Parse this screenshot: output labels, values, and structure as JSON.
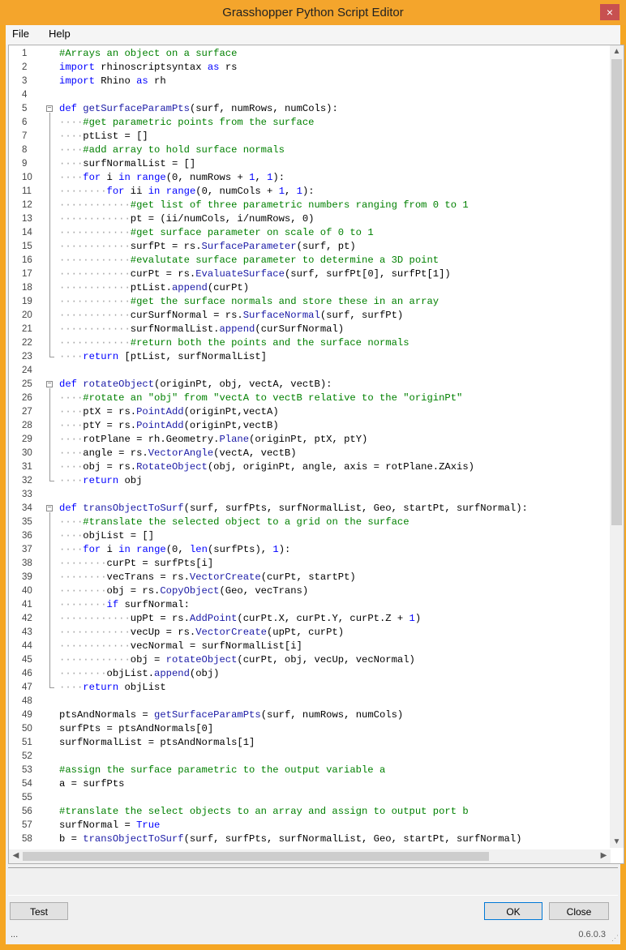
{
  "window": {
    "title": "Grasshopper Python Script Editor",
    "close_glyph": "×"
  },
  "menu": {
    "items": [
      "File",
      "Help"
    ]
  },
  "editor": {
    "lines": [
      {
        "n": "1",
        "indent": 0,
        "parts": [
          [
            "cm",
            "#Arrays an object on a surface"
          ]
        ]
      },
      {
        "n": "2",
        "indent": 0,
        "parts": [
          [
            "kw",
            "import"
          ],
          [
            "",
            " rhinoscriptsyntax "
          ],
          [
            "kw",
            "as"
          ],
          [
            "",
            " rs"
          ]
        ]
      },
      {
        "n": "3",
        "indent": 0,
        "parts": [
          [
            "kw",
            "import"
          ],
          [
            "",
            " Rhino "
          ],
          [
            "kw",
            "as"
          ],
          [
            "",
            " rh"
          ]
        ]
      },
      {
        "n": "4",
        "indent": 0,
        "parts": []
      },
      {
        "n": "5",
        "indent": 0,
        "fold": "start",
        "parts": [
          [
            "kw",
            "def"
          ],
          [
            "",
            " "
          ],
          [
            "fn",
            "getSurfaceParamPts"
          ],
          [
            "",
            "(surf, numRows, numCols):"
          ]
        ]
      },
      {
        "n": "6",
        "indent": 1,
        "parts": [
          [
            "cm",
            "#get parametric points from the surface"
          ]
        ]
      },
      {
        "n": "7",
        "indent": 1,
        "parts": [
          [
            "",
            "ptList = []"
          ]
        ]
      },
      {
        "n": "8",
        "indent": 1,
        "parts": [
          [
            "cm",
            "#add array to hold surface normals"
          ]
        ]
      },
      {
        "n": "9",
        "indent": 1,
        "parts": [
          [
            "",
            "surfNormalList = []"
          ]
        ]
      },
      {
        "n": "10",
        "indent": 1,
        "parts": [
          [
            "kw",
            "for"
          ],
          [
            "",
            " i "
          ],
          [
            "kw",
            "in"
          ],
          [
            "",
            " "
          ],
          [
            "kw",
            "range"
          ],
          [
            "",
            "(0, numRows + "
          ],
          [
            "num",
            "1"
          ],
          [
            "",
            ", "
          ],
          [
            "num",
            "1"
          ],
          [
            "",
            "):"
          ]
        ]
      },
      {
        "n": "11",
        "indent": 2,
        "parts": [
          [
            "kw",
            "for"
          ],
          [
            "",
            " ii "
          ],
          [
            "kw",
            "in"
          ],
          [
            "",
            " "
          ],
          [
            "kw",
            "range"
          ],
          [
            "",
            "(0, numCols + "
          ],
          [
            "num",
            "1"
          ],
          [
            "",
            ", "
          ],
          [
            "num",
            "1"
          ],
          [
            "",
            "):"
          ]
        ]
      },
      {
        "n": "12",
        "indent": 3,
        "parts": [
          [
            "cm",
            "#get list of three parametric numbers ranging from 0 to 1"
          ]
        ]
      },
      {
        "n": "13",
        "indent": 3,
        "parts": [
          [
            "",
            "pt = (ii/numCols, i/numRows, 0)"
          ]
        ]
      },
      {
        "n": "14",
        "indent": 3,
        "parts": [
          [
            "cm",
            "#get surface parameter on scale of 0 to 1"
          ]
        ]
      },
      {
        "n": "15",
        "indent": 3,
        "parts": [
          [
            "",
            "surfPt = rs."
          ],
          [
            "fn",
            "SurfaceParameter"
          ],
          [
            "",
            "(surf, pt)"
          ]
        ]
      },
      {
        "n": "16",
        "indent": 3,
        "parts": [
          [
            "cm",
            "#evalutate surface parameter to determine a 3D point"
          ]
        ]
      },
      {
        "n": "17",
        "indent": 3,
        "parts": [
          [
            "",
            "curPt = rs."
          ],
          [
            "fn",
            "EvaluateSurface"
          ],
          [
            "",
            "(surf, surfPt[0], surfPt[1])"
          ]
        ]
      },
      {
        "n": "18",
        "indent": 3,
        "parts": [
          [
            "",
            "ptList."
          ],
          [
            "fn",
            "append"
          ],
          [
            "",
            "(curPt)"
          ]
        ]
      },
      {
        "n": "19",
        "indent": 3,
        "parts": [
          [
            "cm",
            "#get the surface normals and store these in an array"
          ]
        ]
      },
      {
        "n": "20",
        "indent": 3,
        "parts": [
          [
            "",
            "curSurfNormal = rs."
          ],
          [
            "fn",
            "SurfaceNormal"
          ],
          [
            "",
            "(surf, surfPt)"
          ]
        ]
      },
      {
        "n": "21",
        "indent": 3,
        "parts": [
          [
            "",
            "surfNormalList."
          ],
          [
            "fn",
            "append"
          ],
          [
            "",
            "(curSurfNormal)"
          ]
        ]
      },
      {
        "n": "22",
        "indent": 3,
        "parts": [
          [
            "cm",
            "#return both the points and the surface normals"
          ]
        ]
      },
      {
        "n": "23",
        "indent": 1,
        "fold": "end",
        "parts": [
          [
            "kw",
            "return"
          ],
          [
            "",
            " [ptList, surfNormalList]"
          ]
        ]
      },
      {
        "n": "24",
        "indent": 0,
        "parts": []
      },
      {
        "n": "25",
        "indent": 0,
        "fold": "start",
        "parts": [
          [
            "kw",
            "def"
          ],
          [
            "",
            " "
          ],
          [
            "fn",
            "rotateObject"
          ],
          [
            "",
            "(originPt, obj, vectA, vectB):"
          ]
        ]
      },
      {
        "n": "26",
        "indent": 1,
        "parts": [
          [
            "cm",
            "#rotate an \"obj\" from \"vectA to vectB relative to the \"originPt\""
          ]
        ]
      },
      {
        "n": "27",
        "indent": 1,
        "parts": [
          [
            "",
            "ptX = rs."
          ],
          [
            "fn",
            "PointAdd"
          ],
          [
            "",
            "(originPt,vectA)"
          ]
        ]
      },
      {
        "n": "28",
        "indent": 1,
        "parts": [
          [
            "",
            "ptY = rs."
          ],
          [
            "fn",
            "PointAdd"
          ],
          [
            "",
            "(originPt,vectB)"
          ]
        ]
      },
      {
        "n": "29",
        "indent": 1,
        "parts": [
          [
            "",
            "rotPlane = rh.Geometry."
          ],
          [
            "fn",
            "Plane"
          ],
          [
            "",
            "(originPt, ptX, ptY)"
          ]
        ]
      },
      {
        "n": "30",
        "indent": 1,
        "parts": [
          [
            "",
            "angle = rs."
          ],
          [
            "fn",
            "VectorAngle"
          ],
          [
            "",
            "(vectA, vectB)"
          ]
        ]
      },
      {
        "n": "31",
        "indent": 1,
        "parts": [
          [
            "",
            "obj = rs."
          ],
          [
            "fn",
            "RotateObject"
          ],
          [
            "",
            "(obj, originPt, angle, axis = rotPlane.ZAxis)"
          ]
        ]
      },
      {
        "n": "32",
        "indent": 1,
        "fold": "end",
        "parts": [
          [
            "kw",
            "return"
          ],
          [
            "",
            " obj"
          ]
        ]
      },
      {
        "n": "33",
        "indent": 0,
        "parts": []
      },
      {
        "n": "34",
        "indent": 0,
        "fold": "start",
        "parts": [
          [
            "kw",
            "def"
          ],
          [
            "",
            " "
          ],
          [
            "fn",
            "transObjectToSurf"
          ],
          [
            "",
            "(surf, surfPts, surfNormalList, Geo, startPt, surfNormal):"
          ]
        ]
      },
      {
        "n": "35",
        "indent": 1,
        "parts": [
          [
            "cm",
            "#translate the selected object to a grid on the surface"
          ]
        ]
      },
      {
        "n": "36",
        "indent": 1,
        "parts": [
          [
            "",
            "objList = []"
          ]
        ]
      },
      {
        "n": "37",
        "indent": 1,
        "parts": [
          [
            "kw",
            "for"
          ],
          [
            "",
            " i "
          ],
          [
            "kw",
            "in"
          ],
          [
            "",
            " "
          ],
          [
            "kw",
            "range"
          ],
          [
            "",
            "(0, "
          ],
          [
            "kw",
            "len"
          ],
          [
            "",
            "(surfPts), "
          ],
          [
            "num",
            "1"
          ],
          [
            "",
            "):"
          ]
        ]
      },
      {
        "n": "38",
        "indent": 2,
        "parts": [
          [
            "",
            "curPt = surfPts[i]"
          ]
        ]
      },
      {
        "n": "39",
        "indent": 2,
        "parts": [
          [
            "",
            "vecTrans = rs."
          ],
          [
            "fn",
            "VectorCreate"
          ],
          [
            "",
            "(curPt, startPt)"
          ]
        ]
      },
      {
        "n": "40",
        "indent": 2,
        "parts": [
          [
            "",
            "obj = rs."
          ],
          [
            "fn",
            "CopyObject"
          ],
          [
            "",
            "(Geo, vecTrans)"
          ]
        ]
      },
      {
        "n": "41",
        "indent": 2,
        "parts": [
          [
            "kw",
            "if"
          ],
          [
            "",
            " surfNormal:"
          ]
        ]
      },
      {
        "n": "42",
        "indent": 3,
        "parts": [
          [
            "",
            "upPt = rs."
          ],
          [
            "fn",
            "AddPoint"
          ],
          [
            "",
            "(curPt.X, curPt.Y, curPt.Z + "
          ],
          [
            "num",
            "1"
          ],
          [
            "",
            ")"
          ]
        ]
      },
      {
        "n": "43",
        "indent": 3,
        "parts": [
          [
            "",
            "vecUp = rs."
          ],
          [
            "fn",
            "VectorCreate"
          ],
          [
            "",
            "(upPt, curPt)"
          ]
        ]
      },
      {
        "n": "44",
        "indent": 3,
        "parts": [
          [
            "",
            "vecNormal = surfNormalList[i]"
          ]
        ]
      },
      {
        "n": "45",
        "indent": 3,
        "parts": [
          [
            "",
            "obj = "
          ],
          [
            "fn",
            "rotateObject"
          ],
          [
            "",
            "(curPt, obj, vecUp, vecNormal)"
          ]
        ]
      },
      {
        "n": "46",
        "indent": 2,
        "parts": [
          [
            "",
            "objList."
          ],
          [
            "fn",
            "append"
          ],
          [
            "",
            "(obj)"
          ]
        ]
      },
      {
        "n": "47",
        "indent": 1,
        "fold": "end",
        "parts": [
          [
            "kw",
            "return"
          ],
          [
            "",
            " objList"
          ]
        ]
      },
      {
        "n": "48",
        "indent": 0,
        "parts": []
      },
      {
        "n": "49",
        "indent": 0,
        "parts": [
          [
            "",
            "ptsAndNormals = "
          ],
          [
            "fn",
            "getSurfaceParamPts"
          ],
          [
            "",
            "(surf, numRows, numCols)"
          ]
        ]
      },
      {
        "n": "50",
        "indent": 0,
        "parts": [
          [
            "",
            "surfPts = ptsAndNormals[0]"
          ]
        ]
      },
      {
        "n": "51",
        "indent": 0,
        "parts": [
          [
            "",
            "surfNormalList = ptsAndNormals[1]"
          ]
        ]
      },
      {
        "n": "52",
        "indent": 0,
        "parts": []
      },
      {
        "n": "53",
        "indent": 0,
        "parts": [
          [
            "cm",
            "#assign the surface parametric to the output variable a"
          ]
        ]
      },
      {
        "n": "54",
        "indent": 0,
        "parts": [
          [
            "",
            "a = surfPts"
          ]
        ]
      },
      {
        "n": "55",
        "indent": 0,
        "parts": []
      },
      {
        "n": "56",
        "indent": 0,
        "parts": [
          [
            "cm",
            "#translate the select objects to an array and assign to output port b"
          ]
        ]
      },
      {
        "n": "57",
        "indent": 0,
        "parts": [
          [
            "",
            "surfNormal = "
          ],
          [
            "kw",
            "True"
          ]
        ]
      },
      {
        "n": "58",
        "indent": 0,
        "parts": [
          [
            "",
            "b = "
          ],
          [
            "fn",
            "transObjectToSurf"
          ],
          [
            "",
            "(surf, surfPts, surfNormalList, Geo, startPt, surfNormal)"
          ]
        ]
      }
    ]
  },
  "scrollbars": {
    "up": "▲",
    "down": "▼",
    "left": "◀",
    "right": "▶"
  },
  "buttons": {
    "test": "Test",
    "ok": "OK",
    "close": "Close"
  },
  "status": {
    "left": "...",
    "version": "0.6.0.3",
    "grip": "⋰"
  },
  "colors": {
    "titlebar": "#f4a52c",
    "keyword": "#0000ff",
    "comment": "#008000",
    "function": "#1a1aa6"
  }
}
